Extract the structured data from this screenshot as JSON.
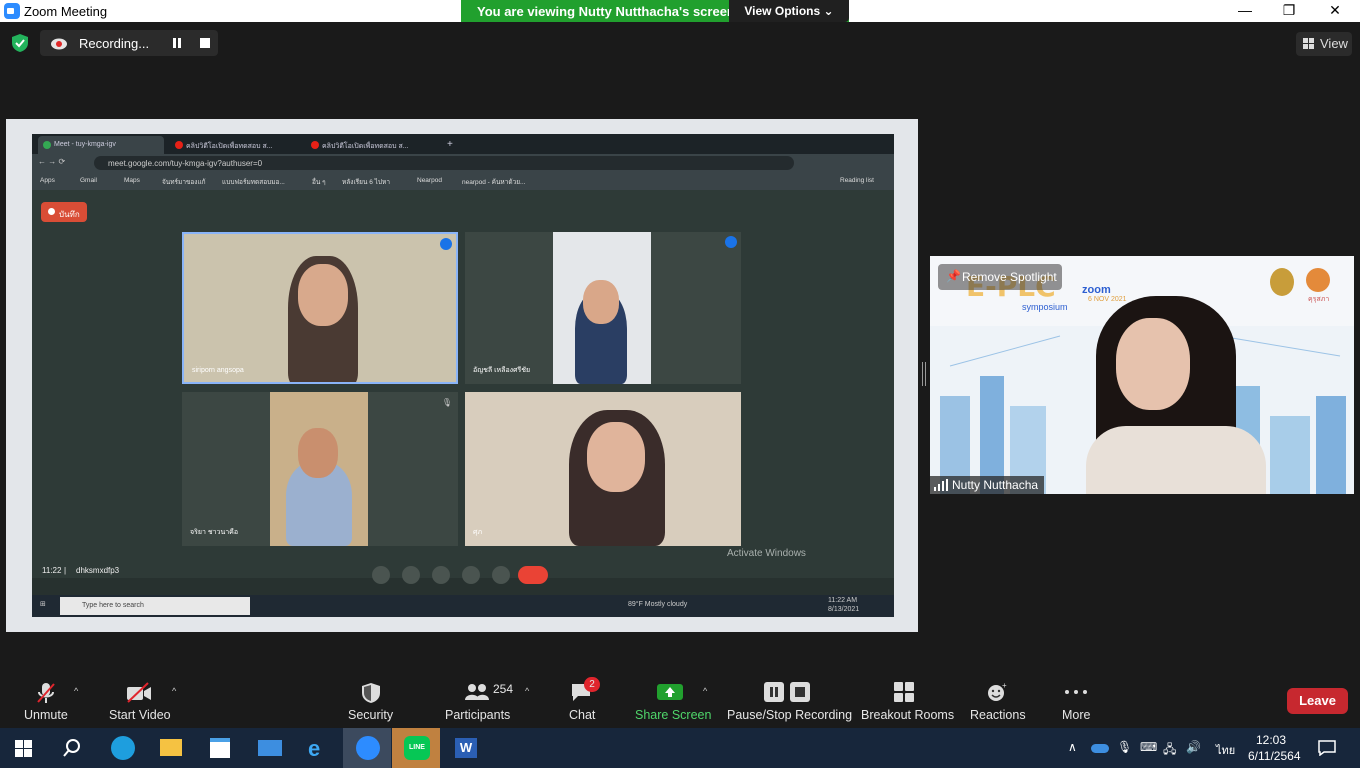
{
  "window": {
    "title": "Zoom Meeting",
    "minimize": "—",
    "maximize": "❐",
    "close": "✕"
  },
  "banner": {
    "text": "You are viewing Nutty Nutthacha's screen",
    "view_options": "View Options"
  },
  "recording": {
    "status": "Recording..."
  },
  "view_button": {
    "label": "View"
  },
  "shared_screen": {
    "tabs": [
      "Meet - tuy-kmga-igv",
      "คลิปวิดีโอเปิดเพื่อทดสอบ ส...",
      "คลิปวิดีโอเปิดเพื่อทดสอบ ส..."
    ],
    "url": "meet.google.com/tuy-kmga-igv?authuser=0",
    "bookmarks": [
      "Apps",
      "Gmail",
      "Maps",
      "จันทร์มาของแก้",
      "แบบฟอร์มทดสอบมอ...",
      "อื่น ๆ",
      "หลังเรียน 6 ไปหา",
      "Nearpod",
      "nearpod - ค้นหาด้วย...",
      "Reading list"
    ],
    "record_chip": "บันทึก",
    "participants": [
      "siriporn angsopa",
      "อัญชลี เหลืองศรีชัย",
      "จริยา ชาวนาคือ",
      "ศุภ"
    ],
    "time": "11:22",
    "meeting_code": "dhksmxdfp3",
    "activate_windows": "Activate Windows",
    "taskbar_search": "Type here to search",
    "weather": "89°F  Mostly cloudy",
    "clock_time": "11:22 AM",
    "clock_date": "8/13/2021"
  },
  "speaker": {
    "spotlight_label": "Remove Spotlight",
    "banner_title": "E-PLC",
    "banner_zoom": "zoom",
    "banner_sub": "symposium",
    "banner_date": "6 NOV 2021",
    "banner_org": "คุรุสภา",
    "name": "Nutty Nutthacha"
  },
  "toolbar": {
    "unmute": "Unmute",
    "start_video": "Start Video",
    "security": "Security",
    "participants": "Participants",
    "participants_count": "254",
    "chat": "Chat",
    "chat_badge": "2",
    "share_screen": "Share Screen",
    "pause_stop": "Pause/Stop Recording",
    "breakout": "Breakout Rooms",
    "reactions": "Reactions",
    "more": "More",
    "leave": "Leave"
  },
  "taskbar": {
    "time": "12:03",
    "date": "6/11/2564",
    "lang": "ไทย",
    "line_label": "LINE"
  },
  "colors": {
    "green_banner": "#21a02e",
    "leave_red": "#c7282f",
    "zoom_blue": "#2d8cff",
    "share_green": "#21a02e"
  }
}
